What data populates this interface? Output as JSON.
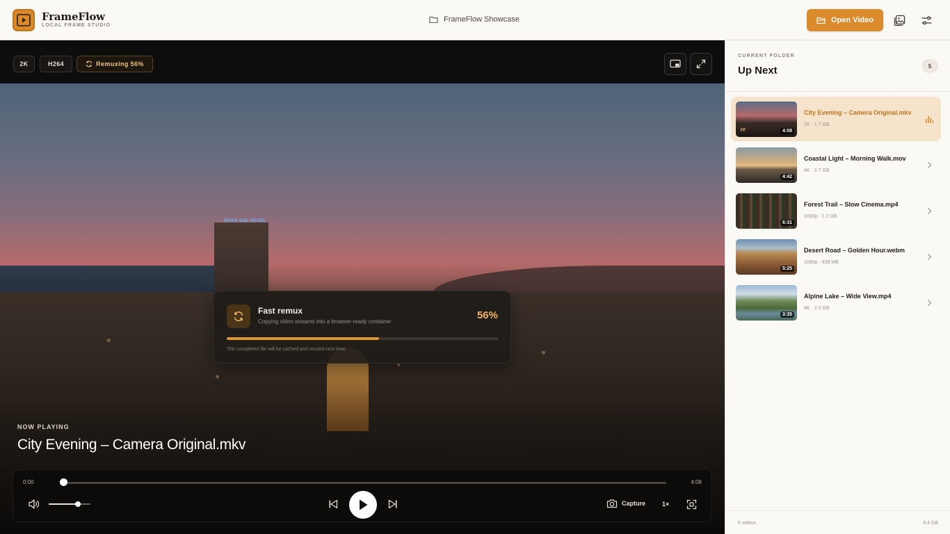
{
  "header": {
    "brand_name": "FrameFlow",
    "brand_sub": "LOCAL FRAME STUDIO",
    "folder": "FrameFlow Showcase",
    "open_button": "Open Video"
  },
  "player": {
    "chips": [
      "2K",
      "H264",
      "Remuxing 56%"
    ],
    "remux": {
      "title": "Fast remux",
      "subtitle": "Copying video streams into a browser-ready container",
      "percent_label": "56%",
      "progress": 0.56,
      "note": "The completed file will be cached and reused next time."
    },
    "now_playing_label": "NOW PLAYING",
    "now_playing_title": "City Evening – Camera Original.mkv",
    "time_current": "0:00",
    "time_total": "4:08",
    "seek_progress": 0.0,
    "volume_level": 0.7,
    "capture_label": "Capture",
    "speed_label": "1×",
    "video_sign": "GRAN SOL HOTEL"
  },
  "sidebar": {
    "label": "CURRENT FOLDER",
    "title": "Up Next",
    "count": "5",
    "items": [
      {
        "title": "City Evening – Camera Original.mkv",
        "meta": "2K · 1.7 GB",
        "duration": "4:08",
        "badge": "FF",
        "active": true
      },
      {
        "title": "Coastal Light – Morning Walk.mov",
        "meta": "4K · 2.7 GB",
        "duration": "4:42",
        "active": false
      },
      {
        "title": "Forest Trail – Slow Cinema.mp4",
        "meta": "1080p · 1.2 GB",
        "duration": "6:31",
        "active": false
      },
      {
        "title": "Desert Road – Golden Hour.webm",
        "meta": "1080p · 939 MB",
        "duration": "5:25",
        "active": false
      },
      {
        "title": "Alpine Lake – Wide View.mp4",
        "meta": "4K · 2.0 GB",
        "duration": "3:35",
        "active": false
      }
    ],
    "footer_left": "5 videos",
    "footer_right": "8.4 GB"
  },
  "colors": {
    "accent": "#db8a2c",
    "accent_dark": "#c0741c",
    "active_row": "#f6e3cc"
  }
}
